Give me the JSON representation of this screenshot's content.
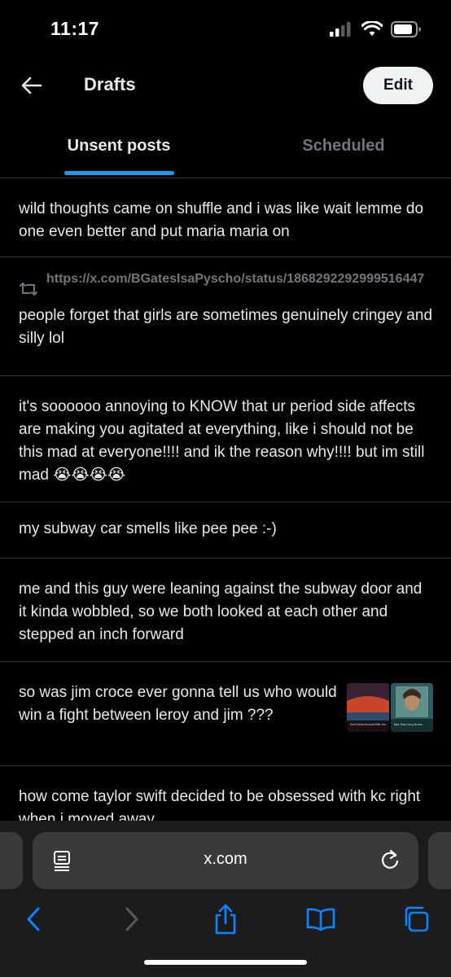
{
  "status_bar": {
    "time": "11:17"
  },
  "header": {
    "title": "Drafts",
    "edit_label": "Edit"
  },
  "tabs": [
    {
      "label": "Unsent posts",
      "active": true
    },
    {
      "label": "Scheduled",
      "active": false
    }
  ],
  "drafts": [
    {
      "text": "wild thoughts came on shuffle and i was like wait lemme do one even better and put maria maria on"
    },
    {
      "quote_link": "https://x.com/BGatesIsaPyscho/status/1868292292999516447",
      "text": "people forget that girls are sometimes genuinely cringey and silly lol"
    },
    {
      "text": "it's soooooo annoying to KNOW that ur period side affects are making you agitated at everything, like i should not be this mad at everyone!!!! and ik the reason why!!!! but im still mad 😭😭😭😭"
    },
    {
      "text": "my subway car smells like pee pee :-)"
    },
    {
      "text": "me and this guy were leaning against the subway door and it kinda wobbled, so we both looked at each other and stepped an inch forward"
    },
    {
      "text": "so was jim croce ever gonna tell us who would win a fight between leroy and jim ???",
      "media": [
        "Don't Mess Around With Jim",
        "Bad, Bad Leroy Brown"
      ]
    },
    {
      "text": "how come taylor swift decided to be obsessed with kc right when i moved away"
    }
  ],
  "browser": {
    "url": "x.com"
  },
  "colors": {
    "accent": "#1d9bf0",
    "ios_blue": "#0a84ff",
    "muted": "#71767b",
    "divider": "#2f3336"
  }
}
